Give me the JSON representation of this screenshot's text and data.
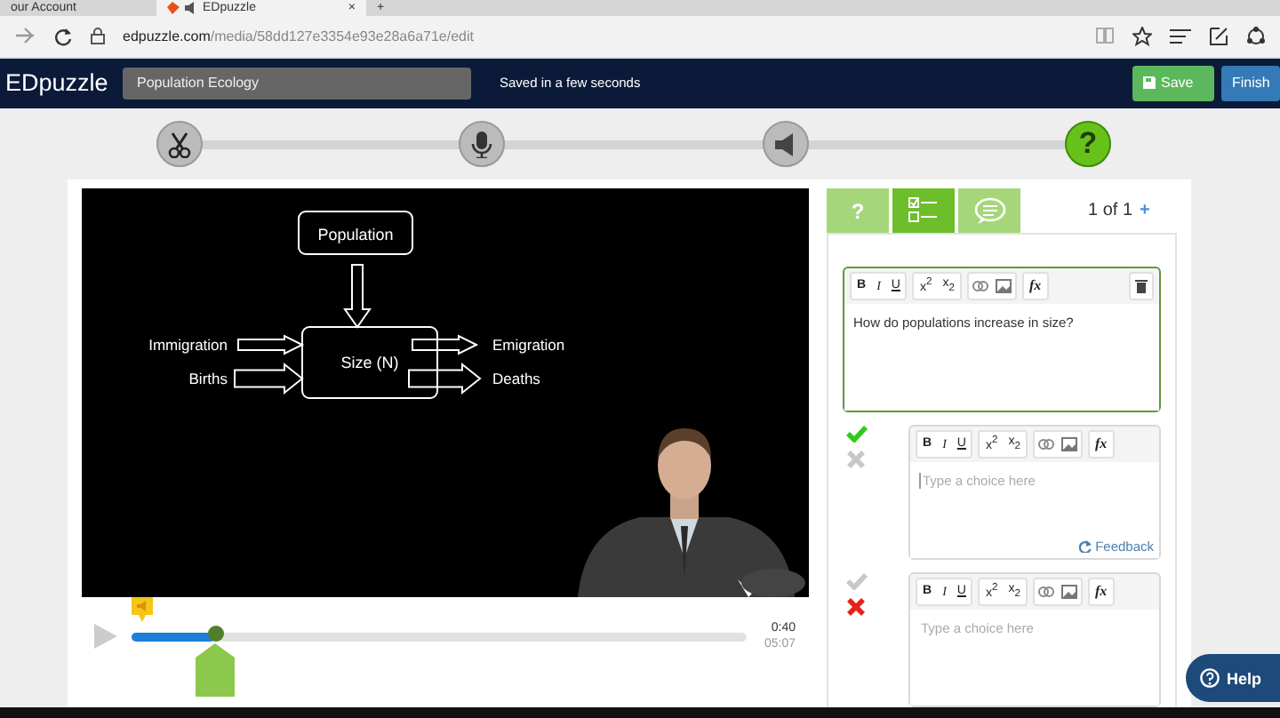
{
  "browser": {
    "tabs": [
      {
        "label": "our Account",
        "selected": false
      },
      {
        "label": "EDpuzzle",
        "selected": true
      }
    ],
    "close": "×",
    "new_tab": "+",
    "url_host": "edpuzzle.com",
    "url_path": "/media/58dd127e3354e93e28a6a71e/edit"
  },
  "header": {
    "logo": "EDpuzzle",
    "title": "Population Ecology",
    "save_status": "Saved in a few seconds",
    "buttons": [
      {
        "kind": "save",
        "label": "Save"
      },
      {
        "kind": "finish",
        "label": "Finish"
      }
    ]
  },
  "steps": [
    {
      "kind": "cut",
      "selected": false
    },
    {
      "kind": "voice",
      "selected": false
    },
    {
      "kind": "audio",
      "selected": false
    },
    {
      "kind": "quiz",
      "selected": true,
      "label": "?"
    }
  ],
  "video": {
    "slide": {
      "top": "Population",
      "center": "Size (N)",
      "inputs": [
        "Immigration",
        "Births"
      ],
      "outputs": [
        "Emigration",
        "Deaths"
      ]
    },
    "level": 0.136,
    "elapsed": "0:40",
    "duration": "05:07"
  },
  "question_panel": {
    "tabs": [
      {
        "kind": "question",
        "label": "?",
        "selected": false
      },
      {
        "kind": "choices",
        "selected": true
      },
      {
        "kind": "comment",
        "selected": false
      }
    ],
    "counter": "1 of 1",
    "add": "+",
    "question": {
      "toolbar": {
        "format": [
          "B",
          "I",
          "U"
        ],
        "script": [
          "x$^{2}$",
          "x$_{2}$"
        ],
        "formula": "fx"
      },
      "text": "How do populations increase in size?"
    },
    "choices": [
      {
        "correct": true,
        "toolbar": {
          "format": [
            "B",
            "I",
            "U"
          ],
          "script": [
            "x$^{2}$",
            "x$_{2}$"
          ],
          "formula": "fx"
        },
        "placeholder": "Type a choice here",
        "feedback": "Feedback"
      },
      {
        "correct": false,
        "toolbar": {
          "format": [
            "B",
            "I",
            "U"
          ],
          "script": [
            "x$^{2}$",
            "x$_{2}$"
          ],
          "formula": "fx"
        },
        "placeholder": "Type a choice here"
      }
    ]
  },
  "help": "Help"
}
